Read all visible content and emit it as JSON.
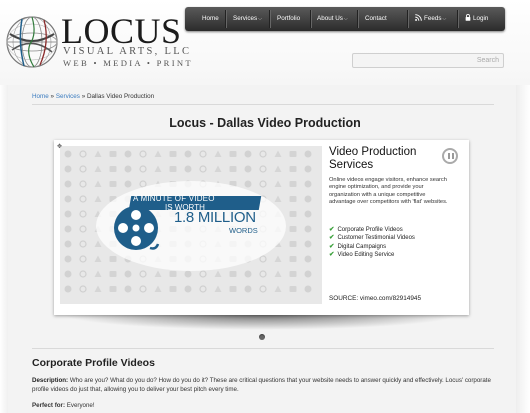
{
  "logo": {
    "word": "LOCUS",
    "sub1": "VISUAL ARTS, LLC",
    "sub2": "WEB • MEDIA • PRINT"
  },
  "nav": {
    "items": [
      {
        "label": "Home"
      },
      {
        "label": "Services",
        "has_caret": true
      },
      {
        "label": "Portfolio"
      },
      {
        "label": "About Us",
        "has_caret": true
      },
      {
        "label": "Contact"
      },
      {
        "label": "Feeds",
        "has_caret": true,
        "icon": "rss-icon"
      },
      {
        "label": "Login",
        "icon": "lock-icon"
      }
    ]
  },
  "search": {
    "button": "Search",
    "placeholder": ""
  },
  "breadcrumb": {
    "home": "Home",
    "sep": "»",
    "services": "Services",
    "current": "Dallas Video Production"
  },
  "page_title": "Locus - Dallas Video Production",
  "slider": {
    "art": {
      "line1": "A MINUTE OF VIDEO",
      "line2": "IS WORTH",
      "big": "1.8 MILLION",
      "words": "WORDS"
    },
    "title": "Video Production Services",
    "description": "Online videos engage visitors, enhance search engine optimization, and provide your organization with a unique competitive advantage over competitors with 'flat' websites.",
    "features": [
      "Corporate Profile Videos",
      "Customer Testimonial Videos",
      "Digital Campaigns",
      "Video Editing Service"
    ],
    "source": "SOURCE: vimeo.com/82914945",
    "pagination_current": 1
  },
  "section": {
    "title": "Corporate Profile Videos",
    "desc_label": "Description:",
    "desc_text": " Who are you? What do you do? How do you do it? These are critical questions that your website needs to answer quickly and effectively. Locus' corporate profile videos do just that, allowing you to deliver your best pitch every time.",
    "perfect_label": "Perfect for:",
    "perfect_text": " Everyone!"
  },
  "colors": {
    "accent": "#1f5e8a",
    "link": "#3a7bbf",
    "nav": "#3a3a3a",
    "check": "#3aa03a"
  }
}
